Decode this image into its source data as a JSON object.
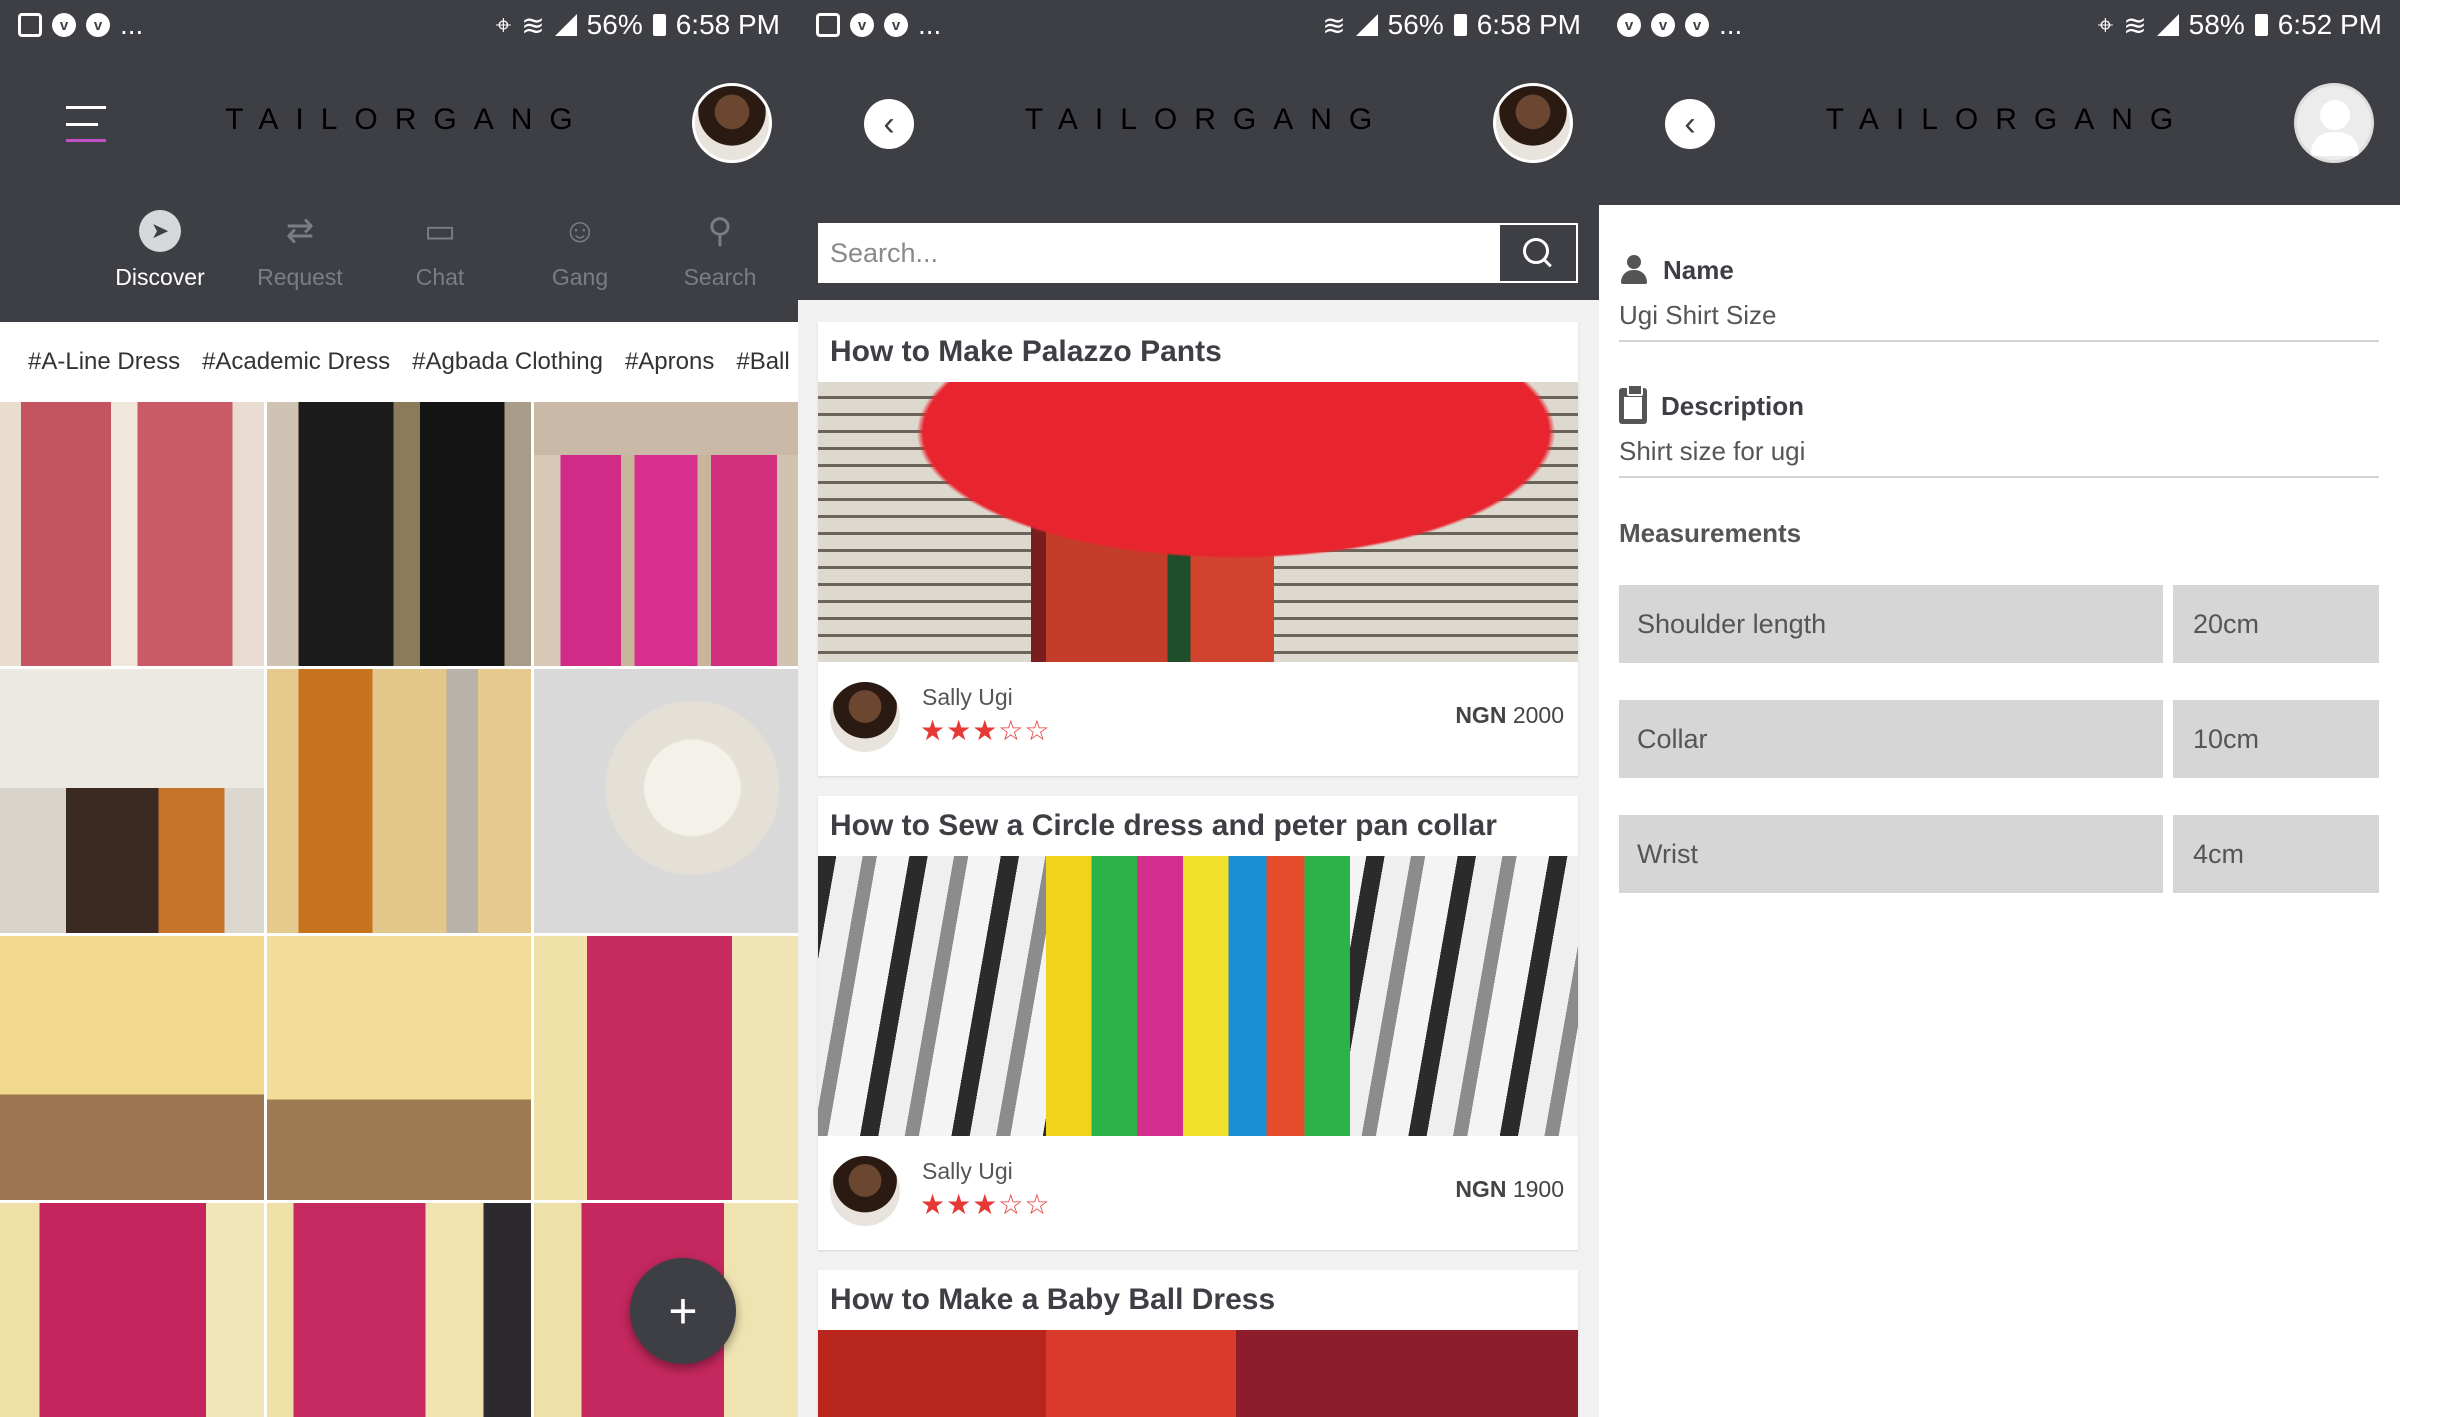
{
  "colors": {
    "header": "#3d3f44",
    "accent": "#c04fc8",
    "stars": "#e53935",
    "field_bg": "#d6d6d6"
  },
  "app": {
    "logo": "TAILORGANG"
  },
  "screen1": {
    "status": {
      "icons": [
        "image-icon",
        "vpn-icon",
        "vpn-icon"
      ],
      "more": "...",
      "battery": "56%",
      "time": "6:58 PM"
    },
    "nav": [
      {
        "label": "Discover",
        "icon": "compass-icon",
        "active": true
      },
      {
        "label": "Request",
        "icon": "swap-icon",
        "active": false
      },
      {
        "label": "Chat",
        "icon": "chat-icon",
        "active": false
      },
      {
        "label": "Gang",
        "icon": "group-icon",
        "active": false
      },
      {
        "label": "Search",
        "icon": "search-icon",
        "active": false
      }
    ],
    "tags": [
      "#A-Line Dress",
      "#Academic Dress",
      "#Agbada Clothing",
      "#Aprons",
      "#Ball"
    ],
    "fab": "+"
  },
  "screen2": {
    "status": {
      "icons": [
        "image-icon",
        "vpn-icon",
        "vpn-icon"
      ],
      "more": "...",
      "battery": "56%",
      "time": "6:58 PM"
    },
    "search_placeholder": "Search...",
    "cards": [
      {
        "title": "How to Make Palazzo Pants",
        "author": "Sally Ugi",
        "rating": 3,
        "currency": "NGN",
        "price": "2000",
        "stars": "★★★☆☆"
      },
      {
        "title": "How to Sew a Circle dress and peter pan collar",
        "author": "Sally Ugi",
        "rating": 3,
        "currency": "NGN",
        "price": "1900",
        "stars": "★★★☆☆"
      },
      {
        "title": "How to Make a Baby Ball Dress"
      }
    ]
  },
  "screen3": {
    "status": {
      "icons": [
        "vpn-icon",
        "vpn-icon",
        "vpn-icon"
      ],
      "more": "...",
      "battery": "58%",
      "time": "6:52 PM"
    },
    "name_label": "Name",
    "name_value": "Ugi Shirt Size",
    "description_label": "Description",
    "description_value": "Shirt size for ugi",
    "measurements_title": "Measurements",
    "measurements": [
      {
        "name": "Shoulder length",
        "value": "20cm"
      },
      {
        "name": "Collar",
        "value": "10cm"
      },
      {
        "name": "Wrist",
        "value": "4cm"
      }
    ]
  }
}
